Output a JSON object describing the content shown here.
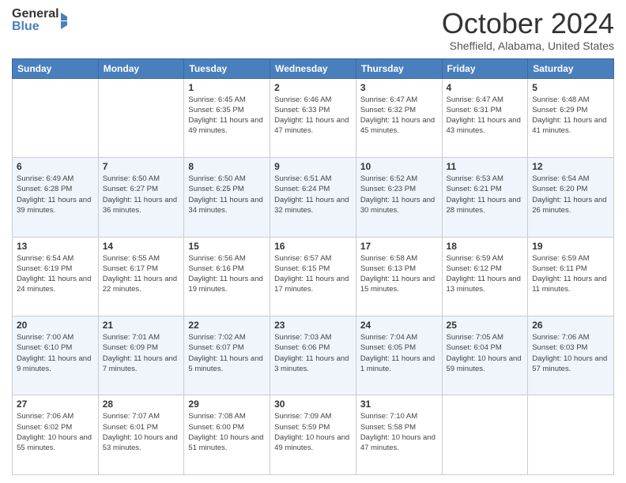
{
  "logo": {
    "general": "General",
    "blue": "Blue"
  },
  "header": {
    "month_title": "October 2024",
    "location": "Sheffield, Alabama, United States"
  },
  "weekdays": [
    "Sunday",
    "Monday",
    "Tuesday",
    "Wednesday",
    "Thursday",
    "Friday",
    "Saturday"
  ],
  "weeks": [
    [
      {
        "day": "",
        "info": ""
      },
      {
        "day": "",
        "info": ""
      },
      {
        "day": "1",
        "info": "Sunrise: 6:45 AM\nSunset: 6:35 PM\nDaylight: 11 hours and 49 minutes."
      },
      {
        "day": "2",
        "info": "Sunrise: 6:46 AM\nSunset: 6:33 PM\nDaylight: 11 hours and 47 minutes."
      },
      {
        "day": "3",
        "info": "Sunrise: 6:47 AM\nSunset: 6:32 PM\nDaylight: 11 hours and 45 minutes."
      },
      {
        "day": "4",
        "info": "Sunrise: 6:47 AM\nSunset: 6:31 PM\nDaylight: 11 hours and 43 minutes."
      },
      {
        "day": "5",
        "info": "Sunrise: 6:48 AM\nSunset: 6:29 PM\nDaylight: 11 hours and 41 minutes."
      }
    ],
    [
      {
        "day": "6",
        "info": "Sunrise: 6:49 AM\nSunset: 6:28 PM\nDaylight: 11 hours and 39 minutes."
      },
      {
        "day": "7",
        "info": "Sunrise: 6:50 AM\nSunset: 6:27 PM\nDaylight: 11 hours and 36 minutes."
      },
      {
        "day": "8",
        "info": "Sunrise: 6:50 AM\nSunset: 6:25 PM\nDaylight: 11 hours and 34 minutes."
      },
      {
        "day": "9",
        "info": "Sunrise: 6:51 AM\nSunset: 6:24 PM\nDaylight: 11 hours and 32 minutes."
      },
      {
        "day": "10",
        "info": "Sunrise: 6:52 AM\nSunset: 6:23 PM\nDaylight: 11 hours and 30 minutes."
      },
      {
        "day": "11",
        "info": "Sunrise: 6:53 AM\nSunset: 6:21 PM\nDaylight: 11 hours and 28 minutes."
      },
      {
        "day": "12",
        "info": "Sunrise: 6:54 AM\nSunset: 6:20 PM\nDaylight: 11 hours and 26 minutes."
      }
    ],
    [
      {
        "day": "13",
        "info": "Sunrise: 6:54 AM\nSunset: 6:19 PM\nDaylight: 11 hours and 24 minutes."
      },
      {
        "day": "14",
        "info": "Sunrise: 6:55 AM\nSunset: 6:17 PM\nDaylight: 11 hours and 22 minutes."
      },
      {
        "day": "15",
        "info": "Sunrise: 6:56 AM\nSunset: 6:16 PM\nDaylight: 11 hours and 19 minutes."
      },
      {
        "day": "16",
        "info": "Sunrise: 6:57 AM\nSunset: 6:15 PM\nDaylight: 11 hours and 17 minutes."
      },
      {
        "day": "17",
        "info": "Sunrise: 6:58 AM\nSunset: 6:13 PM\nDaylight: 11 hours and 15 minutes."
      },
      {
        "day": "18",
        "info": "Sunrise: 6:59 AM\nSunset: 6:12 PM\nDaylight: 11 hours and 13 minutes."
      },
      {
        "day": "19",
        "info": "Sunrise: 6:59 AM\nSunset: 6:11 PM\nDaylight: 11 hours and 11 minutes."
      }
    ],
    [
      {
        "day": "20",
        "info": "Sunrise: 7:00 AM\nSunset: 6:10 PM\nDaylight: 11 hours and 9 minutes."
      },
      {
        "day": "21",
        "info": "Sunrise: 7:01 AM\nSunset: 6:09 PM\nDaylight: 11 hours and 7 minutes."
      },
      {
        "day": "22",
        "info": "Sunrise: 7:02 AM\nSunset: 6:07 PM\nDaylight: 11 hours and 5 minutes."
      },
      {
        "day": "23",
        "info": "Sunrise: 7:03 AM\nSunset: 6:06 PM\nDaylight: 11 hours and 3 minutes."
      },
      {
        "day": "24",
        "info": "Sunrise: 7:04 AM\nSunset: 6:05 PM\nDaylight: 11 hours and 1 minute."
      },
      {
        "day": "25",
        "info": "Sunrise: 7:05 AM\nSunset: 6:04 PM\nDaylight: 10 hours and 59 minutes."
      },
      {
        "day": "26",
        "info": "Sunrise: 7:06 AM\nSunset: 6:03 PM\nDaylight: 10 hours and 57 minutes."
      }
    ],
    [
      {
        "day": "27",
        "info": "Sunrise: 7:06 AM\nSunset: 6:02 PM\nDaylight: 10 hours and 55 minutes."
      },
      {
        "day": "28",
        "info": "Sunrise: 7:07 AM\nSunset: 6:01 PM\nDaylight: 10 hours and 53 minutes."
      },
      {
        "day": "29",
        "info": "Sunrise: 7:08 AM\nSunset: 6:00 PM\nDaylight: 10 hours and 51 minutes."
      },
      {
        "day": "30",
        "info": "Sunrise: 7:09 AM\nSunset: 5:59 PM\nDaylight: 10 hours and 49 minutes."
      },
      {
        "day": "31",
        "info": "Sunrise: 7:10 AM\nSunset: 5:58 PM\nDaylight: 10 hours and 47 minutes."
      },
      {
        "day": "",
        "info": ""
      },
      {
        "day": "",
        "info": ""
      }
    ]
  ]
}
